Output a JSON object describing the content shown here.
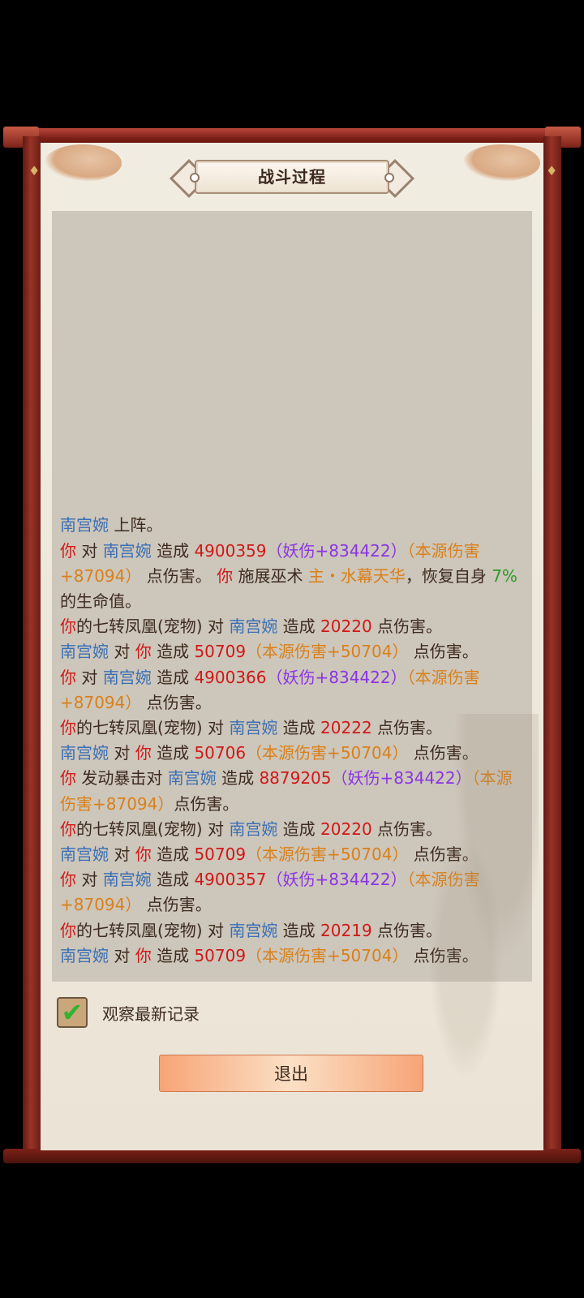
{
  "window": {
    "title": "战斗过程"
  },
  "log": {
    "lines": [
      [
        {
          "t": "南宫婉",
          "c": "blue"
        },
        {
          "t": " 上阵。",
          "c": "brown"
        }
      ],
      [
        {
          "t": "你",
          "c": "red"
        },
        {
          "t": " 对 ",
          "c": "brown"
        },
        {
          "t": "南宫婉",
          "c": "blue"
        },
        {
          "t": " 造成 ",
          "c": "brown"
        },
        {
          "t": "4900359",
          "c": "red"
        },
        {
          "t": "（妖伤+834422）",
          "c": "purple"
        },
        {
          "t": "（本源伤害+87094）",
          "c": "orange"
        },
        {
          "t": " 点伤害。 ",
          "c": "brown"
        },
        {
          "t": "你",
          "c": "red"
        },
        {
          "t": " 施展巫术 ",
          "c": "brown"
        },
        {
          "t": "主・水幕天华",
          "c": "orange"
        },
        {
          "t": "，恢复自身 ",
          "c": "brown"
        },
        {
          "t": "7%",
          "c": "green"
        },
        {
          "t": " 的生命值。",
          "c": "brown"
        }
      ],
      [
        {
          "t": "你",
          "c": "red"
        },
        {
          "t": "的七转凤凰(宠物) 对 ",
          "c": "brown"
        },
        {
          "t": "南宫婉",
          "c": "blue"
        },
        {
          "t": " 造成 ",
          "c": "brown"
        },
        {
          "t": "20220",
          "c": "red"
        },
        {
          "t": " 点伤害。",
          "c": "brown"
        }
      ],
      [
        {
          "t": "南宫婉",
          "c": "blue"
        },
        {
          "t": " 对 ",
          "c": "brown"
        },
        {
          "t": "你",
          "c": "red"
        },
        {
          "t": " 造成 ",
          "c": "brown"
        },
        {
          "t": "50709",
          "c": "red"
        },
        {
          "t": "（本源伤害+50704）",
          "c": "orange"
        },
        {
          "t": " 点伤害。",
          "c": "brown"
        }
      ],
      [
        {
          "t": "你",
          "c": "red"
        },
        {
          "t": " 对 ",
          "c": "brown"
        },
        {
          "t": "南宫婉",
          "c": "blue"
        },
        {
          "t": " 造成 ",
          "c": "brown"
        },
        {
          "t": "4900366",
          "c": "red"
        },
        {
          "t": "（妖伤+834422）",
          "c": "purple"
        },
        {
          "t": "（本源伤害+87094）",
          "c": "orange"
        },
        {
          "t": " 点伤害。",
          "c": "brown"
        }
      ],
      [
        {
          "t": "你",
          "c": "red"
        },
        {
          "t": "的七转凤凰(宠物) 对 ",
          "c": "brown"
        },
        {
          "t": "南宫婉",
          "c": "blue"
        },
        {
          "t": " 造成 ",
          "c": "brown"
        },
        {
          "t": "20222",
          "c": "red"
        },
        {
          "t": " 点伤害。",
          "c": "brown"
        }
      ],
      [
        {
          "t": "南宫婉",
          "c": "blue"
        },
        {
          "t": " 对 ",
          "c": "brown"
        },
        {
          "t": "你",
          "c": "red"
        },
        {
          "t": " 造成 ",
          "c": "brown"
        },
        {
          "t": "50706",
          "c": "red"
        },
        {
          "t": "（本源伤害+50704）",
          "c": "orange"
        },
        {
          "t": " 点伤害。",
          "c": "brown"
        }
      ],
      [
        {
          "t": "你",
          "c": "red"
        },
        {
          "t": " 发动暴击对 ",
          "c": "brown"
        },
        {
          "t": "南宫婉",
          "c": "blue"
        },
        {
          "t": " 造成 ",
          "c": "brown"
        },
        {
          "t": "8879205",
          "c": "red"
        },
        {
          "t": "（妖伤+834422）",
          "c": "purple"
        },
        {
          "t": "（本源伤害+87094）",
          "c": "orange"
        },
        {
          "t": "点伤害。",
          "c": "brown"
        }
      ],
      [
        {
          "t": "你",
          "c": "red"
        },
        {
          "t": "的七转凤凰(宠物) 对 ",
          "c": "brown"
        },
        {
          "t": "南宫婉",
          "c": "blue"
        },
        {
          "t": " 造成 ",
          "c": "brown"
        },
        {
          "t": "20220",
          "c": "red"
        },
        {
          "t": " 点伤害。",
          "c": "brown"
        }
      ],
      [
        {
          "t": "南宫婉",
          "c": "blue"
        },
        {
          "t": " 对 ",
          "c": "brown"
        },
        {
          "t": "你",
          "c": "red"
        },
        {
          "t": " 造成 ",
          "c": "brown"
        },
        {
          "t": "50709",
          "c": "red"
        },
        {
          "t": "（本源伤害+50704）",
          "c": "orange"
        },
        {
          "t": " 点伤害。",
          "c": "brown"
        }
      ],
      [
        {
          "t": "你",
          "c": "red"
        },
        {
          "t": " 对 ",
          "c": "brown"
        },
        {
          "t": "南宫婉",
          "c": "blue"
        },
        {
          "t": " 造成 ",
          "c": "brown"
        },
        {
          "t": "4900357",
          "c": "red"
        },
        {
          "t": "（妖伤+834422）",
          "c": "purple"
        },
        {
          "t": "（本源伤害+87094）",
          "c": "orange"
        },
        {
          "t": " 点伤害。",
          "c": "brown"
        }
      ],
      [
        {
          "t": "你",
          "c": "red"
        },
        {
          "t": "的七转凤凰(宠物) 对 ",
          "c": "brown"
        },
        {
          "t": "南宫婉",
          "c": "blue"
        },
        {
          "t": " 造成 ",
          "c": "brown"
        },
        {
          "t": "20219",
          "c": "red"
        },
        {
          "t": " 点伤害。",
          "c": "brown"
        }
      ],
      [
        {
          "t": "南宫婉",
          "c": "blue"
        },
        {
          "t": " 对 ",
          "c": "brown"
        },
        {
          "t": "你",
          "c": "red"
        },
        {
          "t": " 造成 ",
          "c": "brown"
        },
        {
          "t": "50709",
          "c": "red"
        },
        {
          "t": "（本源伤害+50704）",
          "c": "orange"
        },
        {
          "t": " 点伤害。",
          "c": "brown"
        }
      ]
    ]
  },
  "options": {
    "watch_latest_label": "观察最新记录",
    "watch_latest_checked": true
  },
  "actions": {
    "exit_label": "退出"
  },
  "colors": {
    "blue": "#3a6fb5",
    "red": "#d01818",
    "purple": "#8a34e6",
    "orange": "#d9801a",
    "green": "#2a9a2a",
    "brown": "#3d2a1e"
  }
}
